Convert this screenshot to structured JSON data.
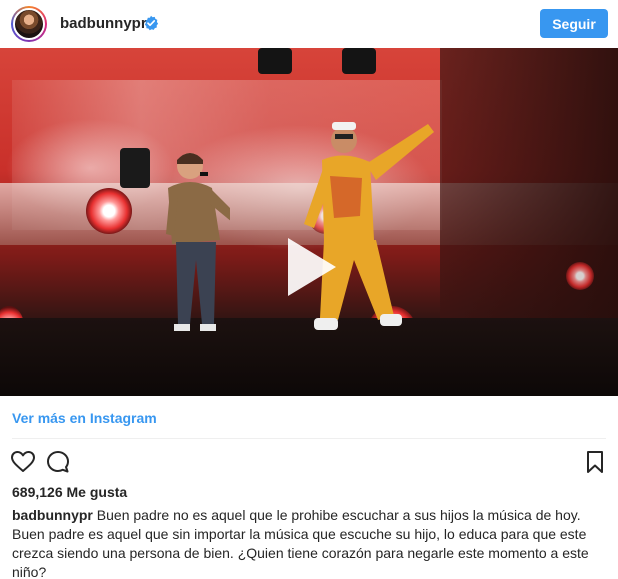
{
  "header": {
    "username": "badbunnypr",
    "follow_label": "Seguir",
    "verified_icon": "verified-badge-icon",
    "accent_color": "#3897f0"
  },
  "media": {
    "type": "video",
    "play_icon": "play-icon"
  },
  "view_more_label": "Ver más en Instagram",
  "actions": {
    "like_icon": "heart-icon",
    "comment_icon": "comment-icon",
    "save_icon": "bookmark-icon"
  },
  "likes_text": "689,126 Me gusta",
  "caption": {
    "username": "badbunnypr",
    "text": "Buen padre no es aquel que le prohibe escuchar a sus hijos la música de hoy. Buen padre es aquel que sin importar la música que escuche su hijo, lo educa para que este crezca siendo una persona de bien. ¿Quien tiene corazón para negarle este momento a este niño?"
  }
}
